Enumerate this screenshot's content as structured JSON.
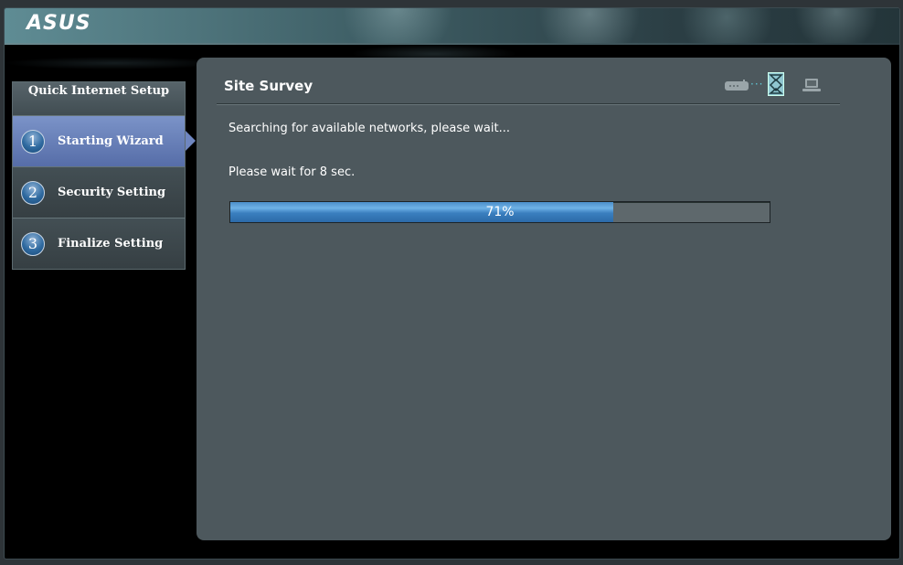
{
  "brand": {
    "logo_text": "ASUS"
  },
  "sidebar": {
    "title": "Quick Internet Setup",
    "items": [
      {
        "number": "1",
        "label": "Starting Wizard",
        "active": true
      },
      {
        "number": "2",
        "label": "Security Setting",
        "active": false
      },
      {
        "number": "3",
        "label": "Finalize Setting",
        "active": false
      }
    ]
  },
  "main": {
    "title": "Site Survey",
    "message": "Searching for available networks, please wait...",
    "wait_text": "Please wait for 8 sec.",
    "progress": {
      "value": 71,
      "label": "71%"
    },
    "step_icons": [
      "router-icon",
      "wifi-icon",
      "laptop-icon"
    ]
  },
  "colors": {
    "panel_bg": "#4d585d",
    "active_item": "#6f86c0",
    "progress_fill": "#3a7fbf",
    "connector_dots": "#5fc8d8"
  }
}
